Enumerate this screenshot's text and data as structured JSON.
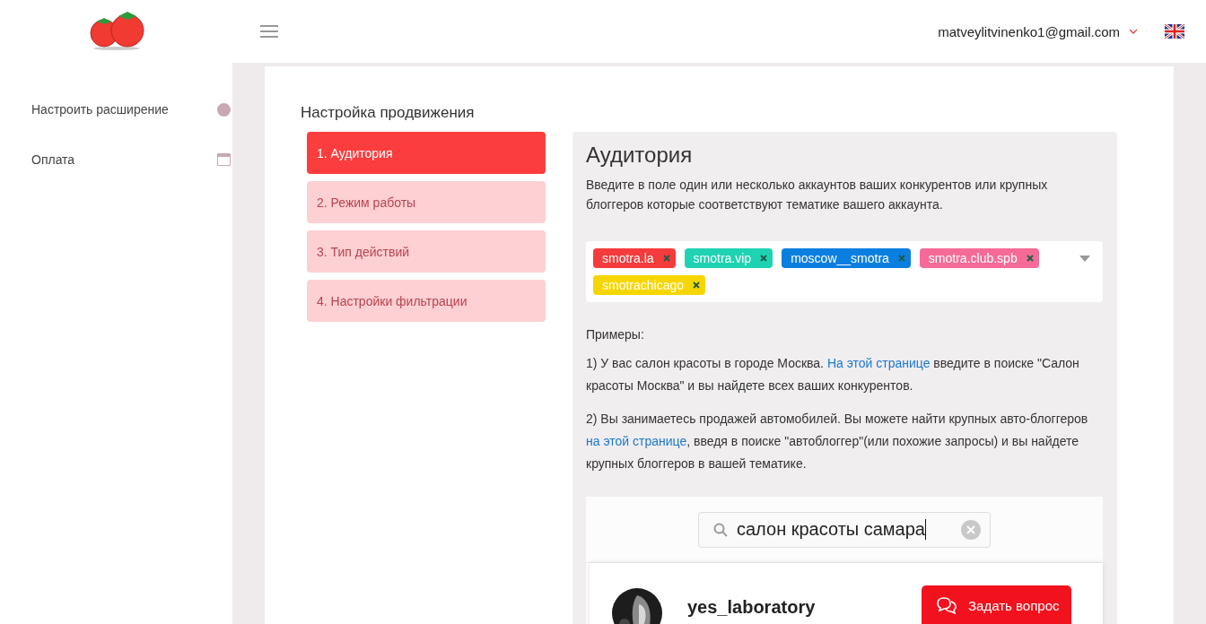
{
  "header": {
    "account": "matveylitvinenko1@gmail.com"
  },
  "sidebar": {
    "items": [
      {
        "label": "Настроить расширение",
        "kind": "dot"
      },
      {
        "label": "Оплата",
        "kind": "card"
      }
    ]
  },
  "page": {
    "title": "Настройка продвижения"
  },
  "steps": [
    {
      "label": "1. Аудитория",
      "selected": true
    },
    {
      "label": "2. Режим работы",
      "selected": false
    },
    {
      "label": "3. Тип действий",
      "selected": false
    },
    {
      "label": "4. Настройки фильтрации",
      "selected": false
    }
  ],
  "panel": {
    "title": "Аудитория",
    "description": "Введите в поле один или несколько аккаунтов ваших конкурентов или крупных блоггеров которые соответствуют тематике вашего аккаунта.",
    "tags": [
      {
        "label": "smotra.la",
        "color": "#f53b3b"
      },
      {
        "label": "smotra.vip",
        "color": "#1fd3b2"
      },
      {
        "label": "moscow__smotra",
        "color": "#0b7fe0"
      },
      {
        "label": "smotra.club.spb",
        "color": "#f56a97"
      },
      {
        "label": "smotrachicago",
        "color": "#f7d600"
      }
    ],
    "examples_title": "Примеры:",
    "examples": [
      [
        {
          "text": "1) У вас салон красоты в городе Москва. "
        },
        {
          "text": "На этой странице",
          "kind": "link"
        },
        {
          "text": " введите в поиске \"Салон красоты Москва\" и вы найдете всех ваших конкурентов."
        }
      ],
      [
        {
          "text": "2) Вы занимаетесь продажей автомобилей. Вы можете найти крупных авто-блоггеров "
        },
        {
          "text": "на этой странице",
          "kind": "link"
        },
        {
          "text": ", введя в поиске \"автоблоггер\"(или похожие запросы) и вы найдете крупных блоггеров в вашей тематике."
        }
      ]
    ],
    "example_screen": {
      "search_value": "салон красоты самара",
      "result_username": "yes_laboratory"
    }
  },
  "chat_button": {
    "label": "Задать вопрос"
  }
}
